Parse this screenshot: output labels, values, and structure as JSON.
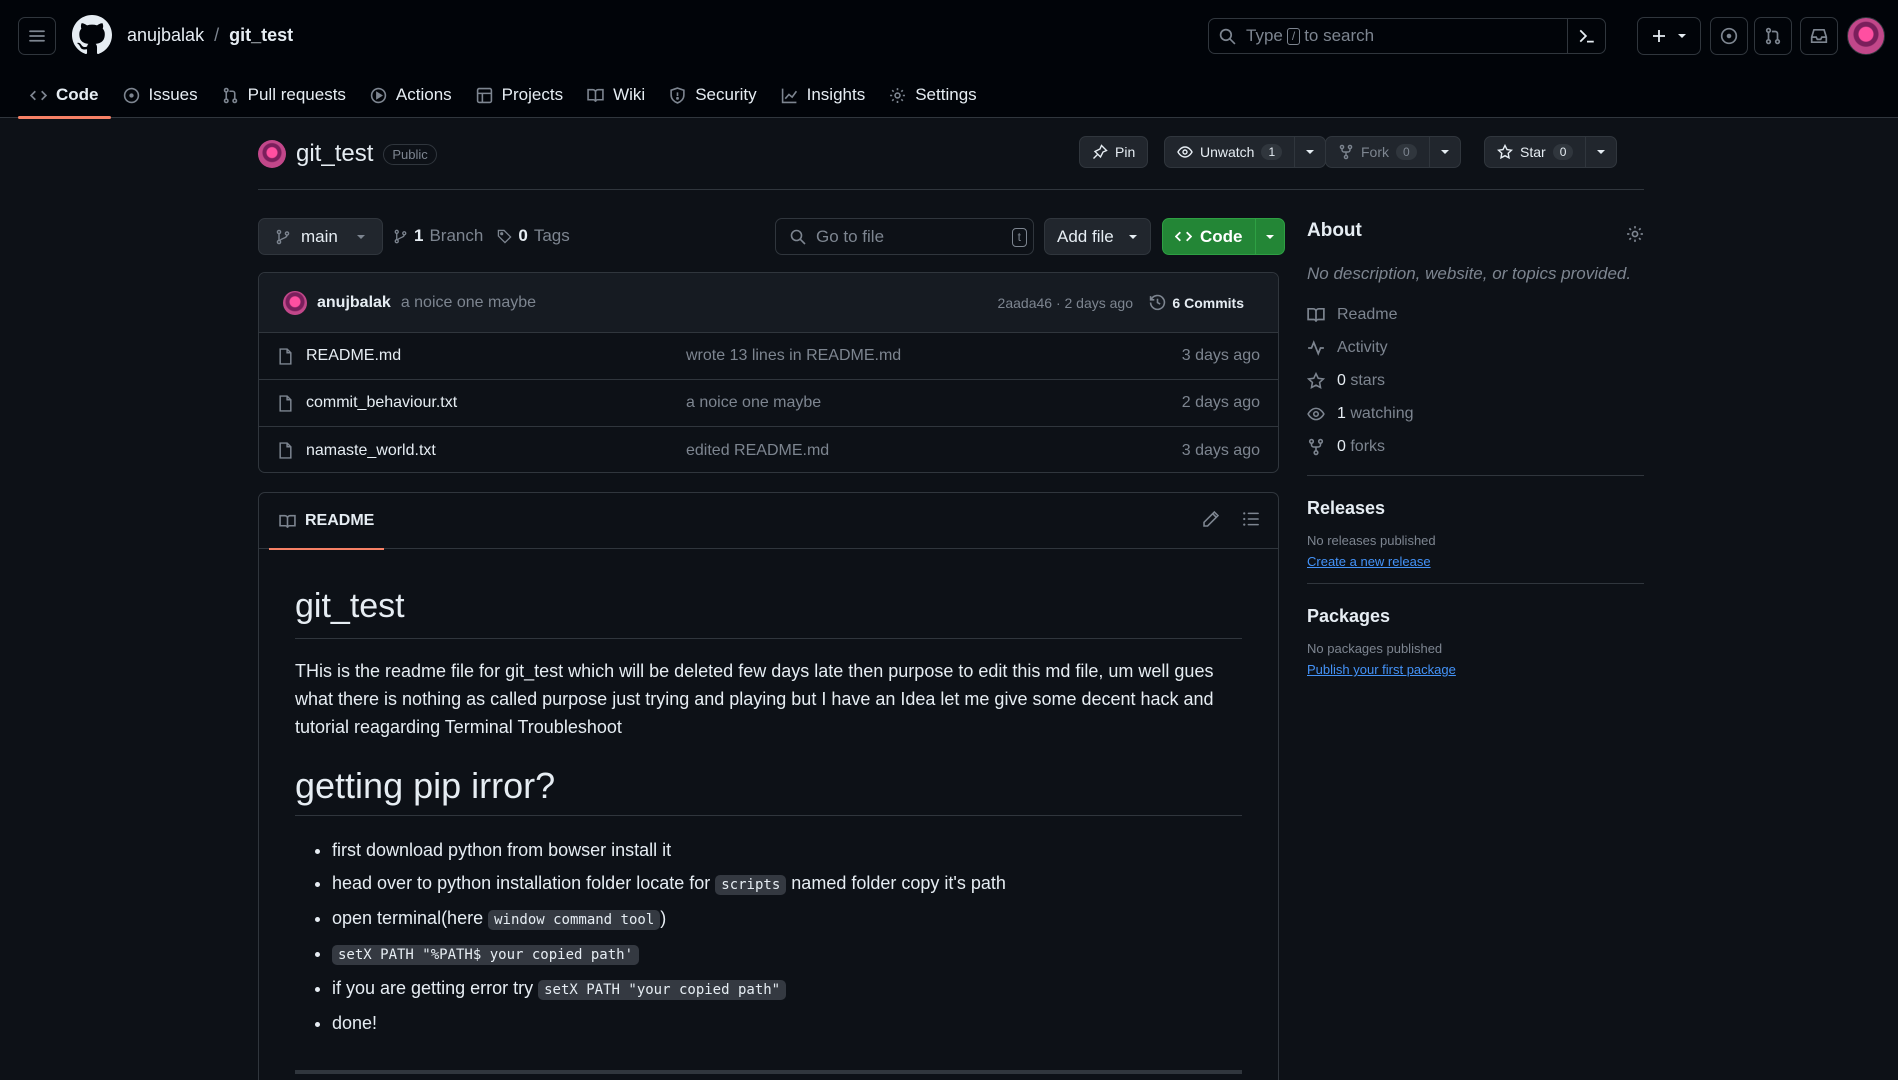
{
  "header": {
    "owner": "anujbalak",
    "separator": "/",
    "repo": "git_test",
    "search_prefix": "Type",
    "search_key": "/",
    "search_suffix": "to search"
  },
  "nav": {
    "code": "Code",
    "issues": "Issues",
    "pulls": "Pull requests",
    "actions": "Actions",
    "projects": "Projects",
    "wiki": "Wiki",
    "security": "Security",
    "insights": "Insights",
    "settings": "Settings"
  },
  "repo": {
    "name": "git_test",
    "visibility": "Public",
    "pin": "Pin",
    "unwatch": "Unwatch",
    "watch_count": "1",
    "fork": "Fork",
    "fork_count": "0",
    "star": "Star",
    "star_count": "0"
  },
  "branchbar": {
    "branch": "main",
    "branch_count": "1",
    "branch_label": "Branch",
    "tag_count": "0",
    "tag_label": "Tags",
    "goto_placeholder": "Go to file",
    "goto_key": "t",
    "add_file": "Add file",
    "code": "Code"
  },
  "commit": {
    "author": "anujbalak",
    "message": "a noice one maybe",
    "meta": "2aada46 · 2 days ago",
    "commits": "6 Commits"
  },
  "files": [
    {
      "name": "README.md",
      "message": "wrote 13 lines in README.md",
      "date": "3 days ago"
    },
    {
      "name": "commit_behaviour.txt",
      "message": "a noice one maybe",
      "date": "2 days ago"
    },
    {
      "name": "namaste_world.txt",
      "message": "edited README.md",
      "date": "3 days ago"
    }
  ],
  "readme": {
    "tab": "README",
    "h1": "git_test",
    "paragraph": "THis is the readme file for git_test which will be deleted few days late then purpose to edit this md file, um well gues what there is nothing as called purpose just trying and playing but I have an Idea let me give some decent hack and tutorial reagarding Terminal Troubleshoot",
    "h2": "getting pip irror?",
    "items": {
      "i1": "first download python from bowser install it",
      "i2_a": "head over to python installation folder locate for",
      "i2_code": "scripts",
      "i2_b": "named folder copy it's path",
      "i3_a": "open terminal(here",
      "i3_code": "window command tool",
      "i3_b": ")",
      "i4_code": "setX PATH \"%PATH$ your copied path'",
      "i5_a": "if you are getting error try",
      "i5_code": "setX PATH \"your copied path\"",
      "i6": "done!"
    }
  },
  "sidebar": {
    "about": "About",
    "description": "No description, website, or topics provided.",
    "readme": "Readme",
    "activity": "Activity",
    "stars_count": "0",
    "stars": "stars",
    "watching_count": "1",
    "watching": "watching",
    "forks_count": "0",
    "forks": "forks",
    "releases": "Releases",
    "no_releases": "No releases published",
    "create_release": "Create a new release",
    "packages": "Packages",
    "no_packages": "No packages published",
    "publish_package": "Publish your first package"
  },
  "colors": {
    "background": "#0d1117",
    "header": "#010409",
    "accent_underline": "#f78166",
    "code_button": "#238636",
    "link": "#4493f8"
  }
}
